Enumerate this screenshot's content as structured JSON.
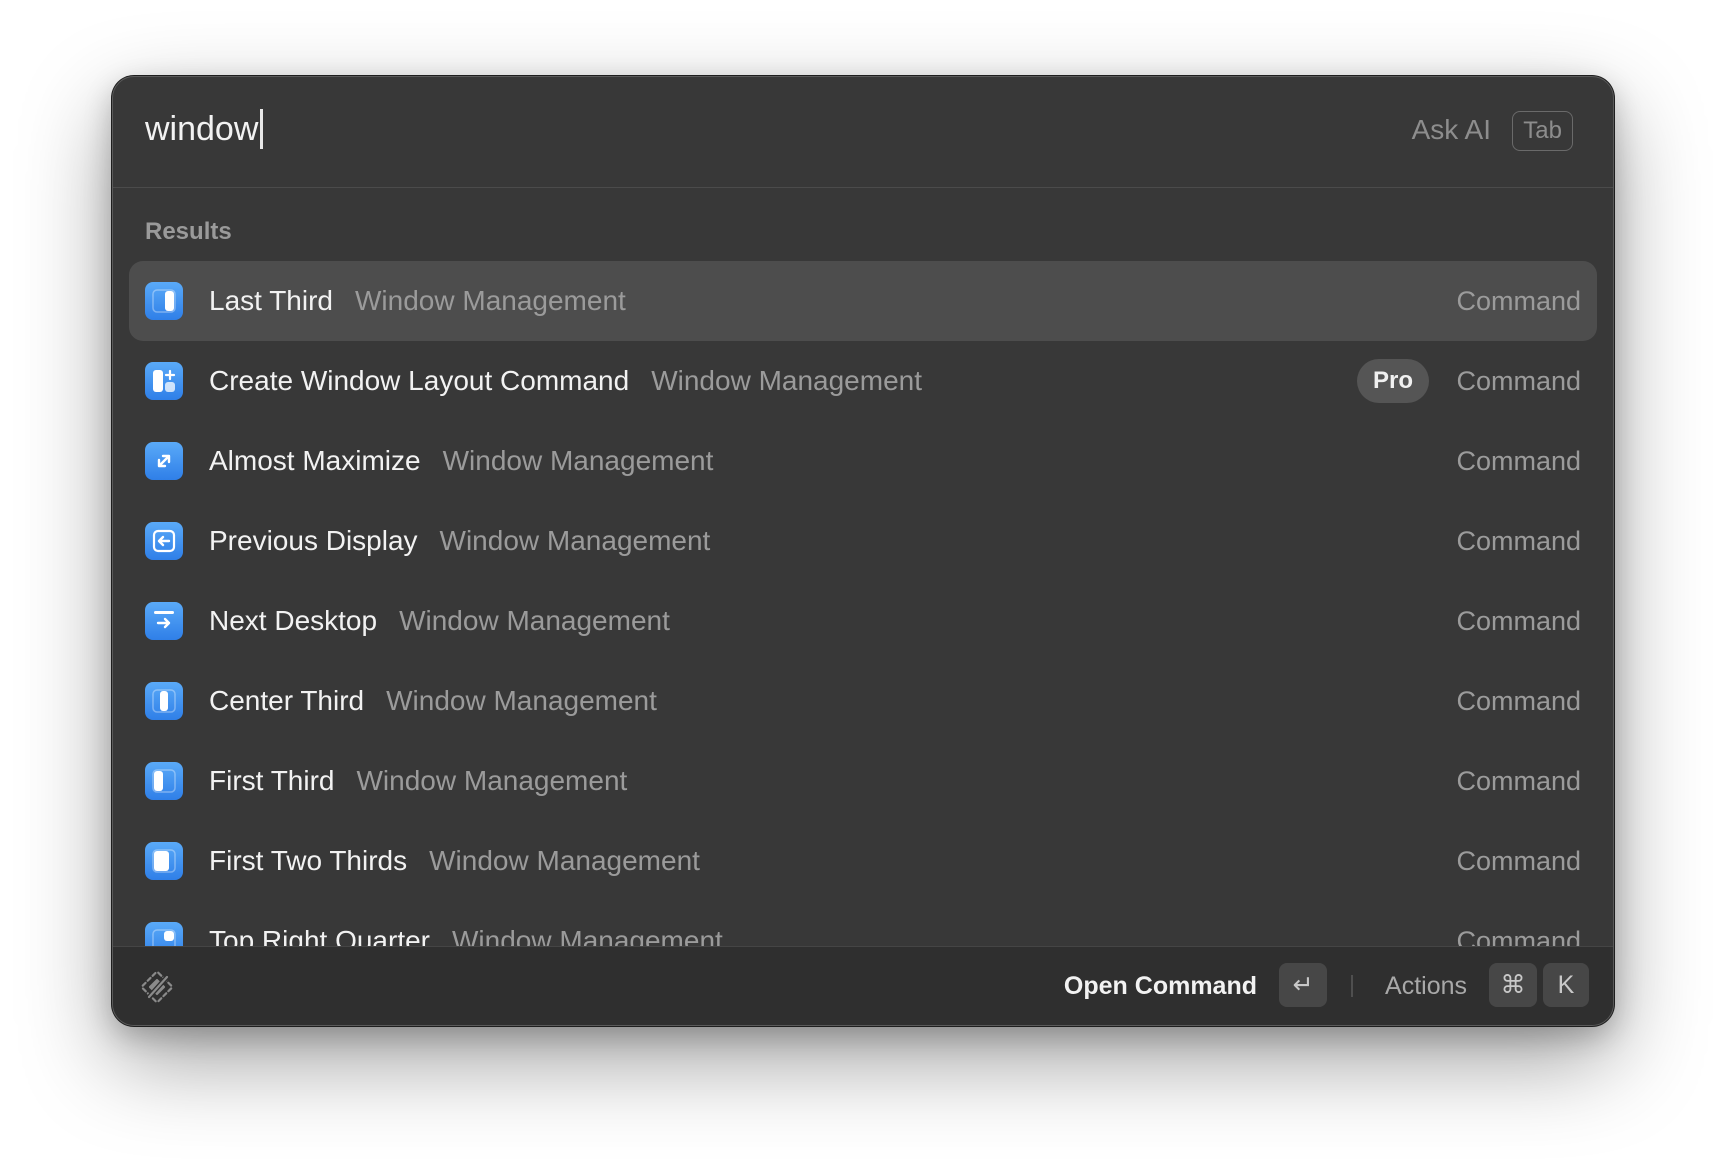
{
  "search": {
    "query": "window",
    "ask_ai_label": "Ask AI",
    "tab_key": "Tab"
  },
  "results": {
    "section_title": "Results",
    "items": [
      {
        "title": "Last Third",
        "subtitle": "Window Management",
        "type": "Command",
        "icon": "last-third-icon",
        "selected": true
      },
      {
        "title": "Create Window Layout Command",
        "subtitle": "Window Management",
        "type": "Command",
        "icon": "window-layout-icon",
        "badge": "Pro"
      },
      {
        "title": "Almost Maximize",
        "subtitle": "Window Management",
        "type": "Command",
        "icon": "almost-maximize-icon"
      },
      {
        "title": "Previous Display",
        "subtitle": "Window Management",
        "type": "Command",
        "icon": "previous-display-icon"
      },
      {
        "title": "Next Desktop",
        "subtitle": "Window Management",
        "type": "Command",
        "icon": "next-desktop-icon"
      },
      {
        "title": "Center Third",
        "subtitle": "Window Management",
        "type": "Command",
        "icon": "center-third-icon"
      },
      {
        "title": "First Third",
        "subtitle": "Window Management",
        "type": "Command",
        "icon": "first-third-icon"
      },
      {
        "title": "First Two Thirds",
        "subtitle": "Window Management",
        "type": "Command",
        "icon": "first-two-thirds-icon"
      },
      {
        "title": "Top Right Quarter",
        "subtitle": "Window Management",
        "type": "Command",
        "icon": "top-right-quarter-icon"
      }
    ]
  },
  "footer": {
    "primary_action": "Open Command",
    "enter_key": "↵",
    "actions_label": "Actions",
    "cmd_key": "⌘",
    "k_key": "K"
  },
  "colors": {
    "window_bg": "#383838",
    "selected_row": "#4d4d4d",
    "icon_accent": "#3d8ef0"
  }
}
